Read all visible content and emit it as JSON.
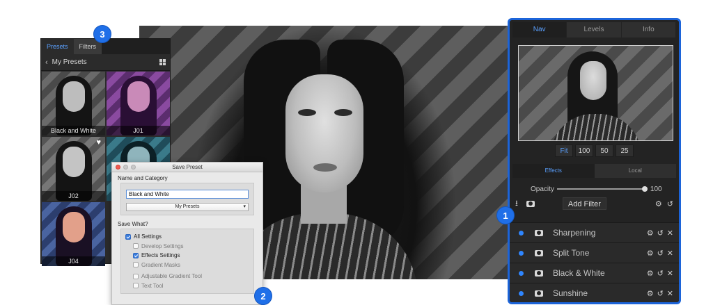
{
  "presets_panel": {
    "tabs": [
      "Presets",
      "Filters"
    ],
    "header": "My Presets",
    "thumbnails": [
      {
        "label": "Black and White",
        "tone": "bw"
      },
      {
        "label": "J01",
        "tone": "purple"
      },
      {
        "label": "J02",
        "tone": "bw2"
      },
      {
        "label": "",
        "tone": "teal"
      },
      {
        "label": "J04",
        "tone": "warm"
      }
    ]
  },
  "save_dialog": {
    "title": "Save Preset",
    "name_section": "Name and Category",
    "name_value": "Black and White",
    "category_value": "My Presets",
    "save_what_section": "Save What?",
    "options": [
      {
        "label": "All Settings",
        "checked": true,
        "sub": false
      },
      {
        "label": "Develop Settings",
        "checked": false,
        "sub": true
      },
      {
        "label": "Effects Settings",
        "checked": true,
        "sub": true
      },
      {
        "label": "Gradient Masks",
        "checked": false,
        "sub": true
      },
      {
        "label": "Adjustable Gradient Tool",
        "checked": false,
        "sub": true
      },
      {
        "label": "Text Tool",
        "checked": false,
        "sub": true
      }
    ]
  },
  "right_panel": {
    "tabs": [
      "Nav",
      "Levels",
      "Info"
    ],
    "zoom_buttons": [
      "Fit",
      "100",
      "50",
      "25"
    ],
    "effect_tabs": [
      "Effects",
      "Local"
    ],
    "opacity_label": "Opacity",
    "opacity_value": "100",
    "add_filter_label": "Add Filter",
    "filters": [
      "Sharpening",
      "Split Tone",
      "Black & White",
      "Sunshine"
    ]
  },
  "badges": [
    "1",
    "2",
    "3"
  ],
  "colors": {
    "accent": "#1f6fe8",
    "active_text": "#5aa0ff"
  }
}
